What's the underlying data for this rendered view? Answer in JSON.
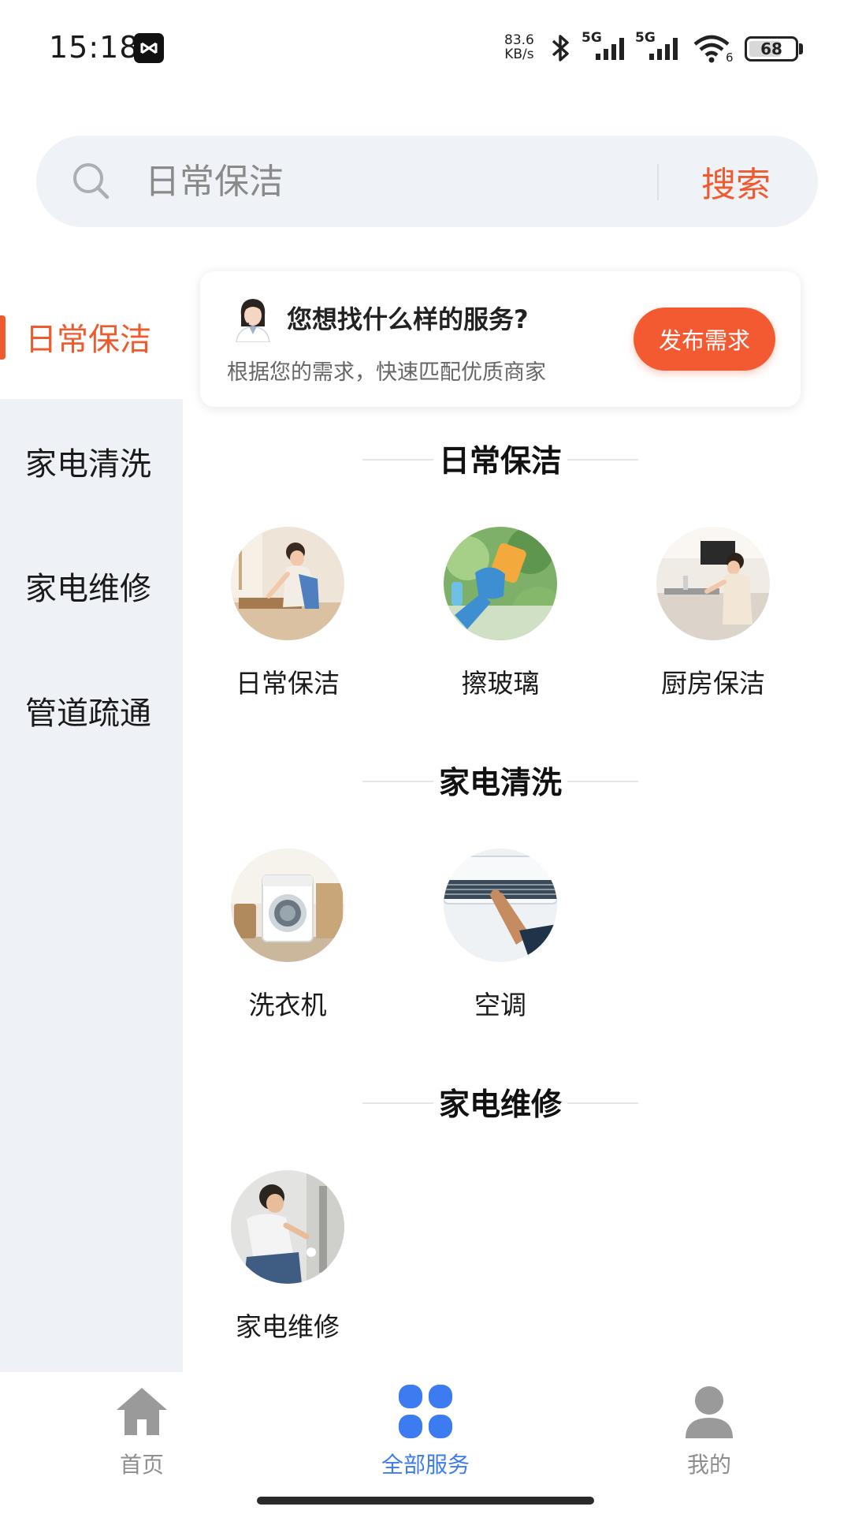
{
  "status_bar": {
    "time": "15:18",
    "net_speed_value": "83.6",
    "net_speed_unit": "KB/s",
    "signal_1_label": "5G",
    "signal_2_label": "5G",
    "wifi_label": "6",
    "battery": "68",
    "icons": [
      "capcut-icon",
      "bluetooth-icon",
      "signal-icon",
      "signal-icon",
      "wifi-icon",
      "battery-icon"
    ]
  },
  "search": {
    "placeholder": "日常保洁",
    "button_label": "搜索"
  },
  "sidebar": {
    "items": [
      {
        "label": "日常保洁",
        "active": true
      },
      {
        "label": "家电清洗",
        "active": false
      },
      {
        "label": "家电维修",
        "active": false
      },
      {
        "label": "管道疏通",
        "active": false
      }
    ]
  },
  "promo": {
    "title": "您想找什么样的服务?",
    "subtitle": "根据您的需求，快速匹配优质商家",
    "button_label": "发布需求"
  },
  "sections": [
    {
      "title": "日常保洁",
      "services": [
        {
          "label": "日常保洁"
        },
        {
          "label": "擦玻璃"
        },
        {
          "label": "厨房保洁"
        }
      ]
    },
    {
      "title": "家电清洗",
      "services": [
        {
          "label": "洗衣机"
        },
        {
          "label": "空调"
        }
      ]
    },
    {
      "title": "家电维修",
      "services": [
        {
          "label": "家电维修"
        }
      ]
    }
  ],
  "bottom_nav": {
    "items": [
      {
        "label": "首页",
        "icon": "home-icon",
        "active": false
      },
      {
        "label": "全部服务",
        "icon": "grid-icon",
        "active": true
      },
      {
        "label": "我的",
        "icon": "profile-icon",
        "active": false
      }
    ]
  },
  "colors": {
    "accent": "#ef5a2e",
    "nav_active": "#3d7cf0",
    "sidebar_bg": "#eef1f5",
    "search_bg": "#eff2f6"
  }
}
